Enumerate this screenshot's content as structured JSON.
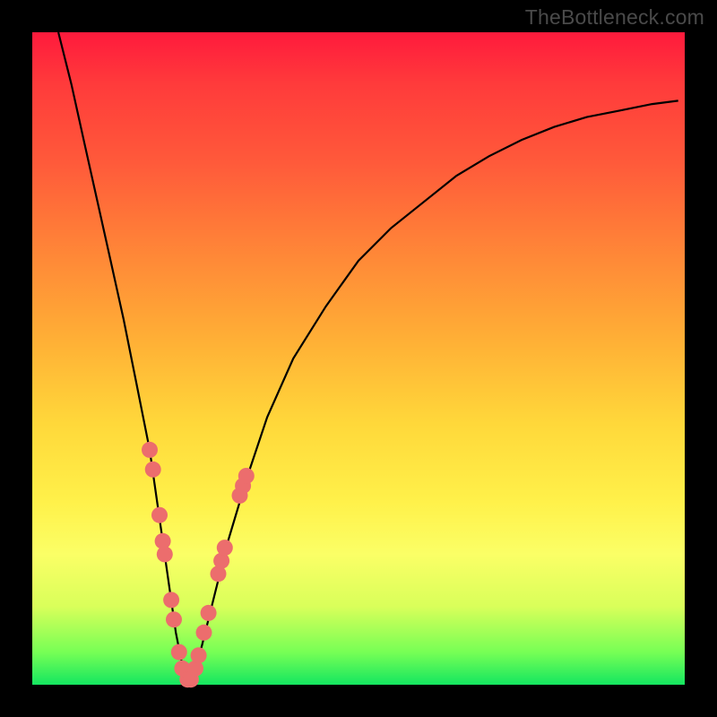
{
  "watermark": "TheBottleneck.com",
  "colors": {
    "gradient_top": "#ff1a3c",
    "gradient_mid1": "#ff8a37",
    "gradient_mid2": "#fff14a",
    "gradient_bottom": "#14e660",
    "curve": "#000000",
    "markers": "#ec6d6d",
    "frame": "#000000"
  },
  "chart_data": {
    "type": "line",
    "title": "",
    "xlabel": "",
    "ylabel": "",
    "xlim": [
      0,
      100
    ],
    "ylim": [
      0,
      100
    ],
    "note": "Axes are unlabeled in the source image; values are read from relative pixel position on a 0–100 scale.",
    "series": [
      {
        "name": "bottleneck-curve",
        "x": [
          4,
          6,
          8,
          10,
          12,
          14,
          16,
          18,
          20,
          21,
          22,
          23,
          23.5,
          24,
          24.5,
          25,
          26,
          28,
          30,
          33,
          36,
          40,
          45,
          50,
          55,
          60,
          65,
          70,
          75,
          80,
          85,
          90,
          95,
          99
        ],
        "y": [
          100,
          92,
          83,
          74,
          65,
          56,
          46,
          36,
          22,
          15,
          8,
          3,
          1,
          0.5,
          1,
          2.5,
          6,
          14,
          22,
          32,
          41,
          50,
          58,
          65,
          70,
          74,
          78,
          81,
          83.5,
          85.5,
          87,
          88,
          89,
          89.5
        ]
      }
    ],
    "markers": {
      "name": "highlighted-points",
      "points": [
        {
          "x": 18.0,
          "y": 36
        },
        {
          "x": 18.5,
          "y": 33
        },
        {
          "x": 19.5,
          "y": 26
        },
        {
          "x": 20.0,
          "y": 22
        },
        {
          "x": 20.3,
          "y": 20
        },
        {
          "x": 21.3,
          "y": 13
        },
        {
          "x": 21.7,
          "y": 10
        },
        {
          "x": 22.5,
          "y": 5
        },
        {
          "x": 23.0,
          "y": 2.5
        },
        {
          "x": 23.8,
          "y": 0.8
        },
        {
          "x": 24.3,
          "y": 0.8
        },
        {
          "x": 25.0,
          "y": 2.5
        },
        {
          "x": 25.5,
          "y": 4.5
        },
        {
          "x": 26.3,
          "y": 8
        },
        {
          "x": 27.0,
          "y": 11
        },
        {
          "x": 28.5,
          "y": 17
        },
        {
          "x": 29.0,
          "y": 19
        },
        {
          "x": 29.5,
          "y": 21
        },
        {
          "x": 31.8,
          "y": 29
        },
        {
          "x": 32.3,
          "y": 30.5
        },
        {
          "x": 32.8,
          "y": 32
        }
      ]
    }
  }
}
